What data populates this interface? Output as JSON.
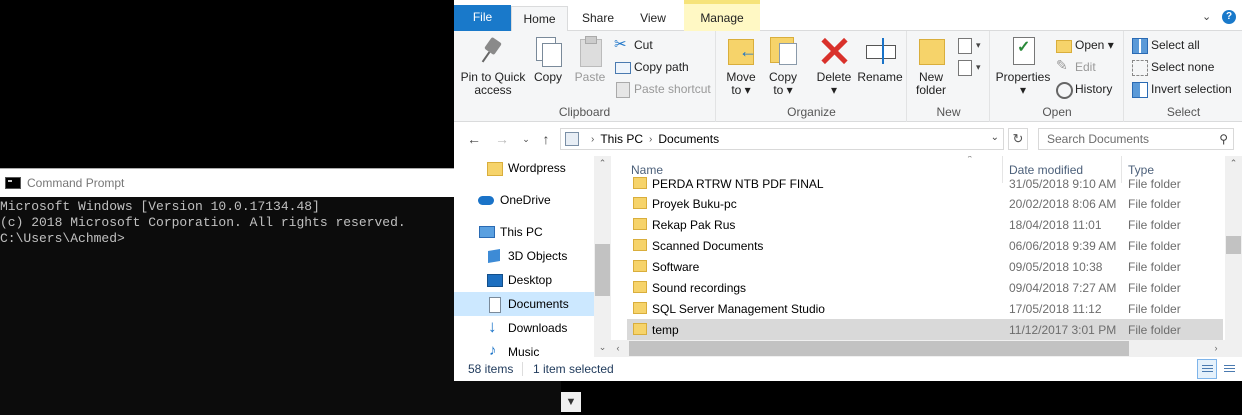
{
  "cmd": {
    "title": "Command Prompt",
    "lines": [
      "Microsoft Windows [Version 10.0.17134.48]",
      "(c) 2018 Microsoft Corporation. All rights reserved.",
      "",
      "C:\\Users\\Achmed>"
    ]
  },
  "explorer": {
    "tabs": {
      "file": "File",
      "home": "Home",
      "share": "Share",
      "view": "View",
      "manage": "Manage"
    },
    "ribbon": {
      "clipboard": {
        "label": "Clipboard",
        "pin_line1": "Pin to Quick",
        "pin_line2": "access",
        "copy": "Copy",
        "paste": "Paste",
        "cut": "Cut",
        "copy_path": "Copy path",
        "paste_shortcut": "Paste shortcut"
      },
      "organize": {
        "label": "Organize",
        "move_line1": "Move",
        "move_line2": "to ▾",
        "copy_line1": "Copy",
        "copy_line2": "to ▾",
        "delete": "Delete",
        "delete_arrow": "▾",
        "rename": "Rename"
      },
      "new": {
        "label": "New",
        "folder_line1": "New",
        "folder_line2": "folder"
      },
      "open": {
        "label": "Open",
        "properties": "Properties",
        "properties_arrow": "▾",
        "open": "Open ▾",
        "edit": "Edit",
        "history": "History"
      },
      "select": {
        "label": "Select",
        "select_all": "Select all",
        "select_none": "Select none",
        "invert_selection": "Invert selection"
      }
    },
    "address": {
      "crumbs": [
        "This PC",
        "Documents"
      ],
      "search_placeholder": "Search Documents"
    },
    "nav_items": [
      {
        "label": "Wordpress",
        "icon": "folder-icon"
      },
      {
        "label": "OneDrive",
        "icon": "onedrive-icon"
      },
      {
        "label": "This PC",
        "icon": "pc-icon"
      },
      {
        "label": "3D Objects",
        "icon": "3d-objects-icon"
      },
      {
        "label": "Desktop",
        "icon": "desktop-icon"
      },
      {
        "label": "Documents",
        "icon": "documents-icon",
        "selected": true
      },
      {
        "label": "Downloads",
        "icon": "downloads-icon"
      },
      {
        "label": "Music",
        "icon": "music-icon"
      }
    ],
    "columns": {
      "name": "Name",
      "date": "Date modified",
      "type": "Type"
    },
    "files": [
      {
        "name": "PERDA RTRW NTB PDF FINAL",
        "date": "31/05/2018 9:10 AM",
        "type": "File folder"
      },
      {
        "name": "Proyek Buku-pc",
        "date": "20/02/2018 8:06 AM",
        "type": "File folder"
      },
      {
        "name": "Rekap Pak Rus",
        "date": "18/04/2018 11:01",
        "type": "File folder"
      },
      {
        "name": "Scanned Documents",
        "date": "06/06/2018 9:39 AM",
        "type": "File folder"
      },
      {
        "name": "Software",
        "date": "09/05/2018 10:38",
        "type": "File folder"
      },
      {
        "name": "Sound recordings",
        "date": "09/04/2018 7:27 AM",
        "type": "File folder"
      },
      {
        "name": "SQL Server Management Studio",
        "date": "17/05/2018 11:12",
        "type": "File folder"
      },
      {
        "name": "temp",
        "date": "11/12/2017 3:01 PM",
        "type": "File folder",
        "selected": true
      }
    ],
    "status": {
      "items": "58 items",
      "selected": "1 item selected"
    }
  },
  "colors": {
    "accent": "#1979ca",
    "selection": "#cce8ff",
    "manage_tab": "#fff8c4"
  }
}
